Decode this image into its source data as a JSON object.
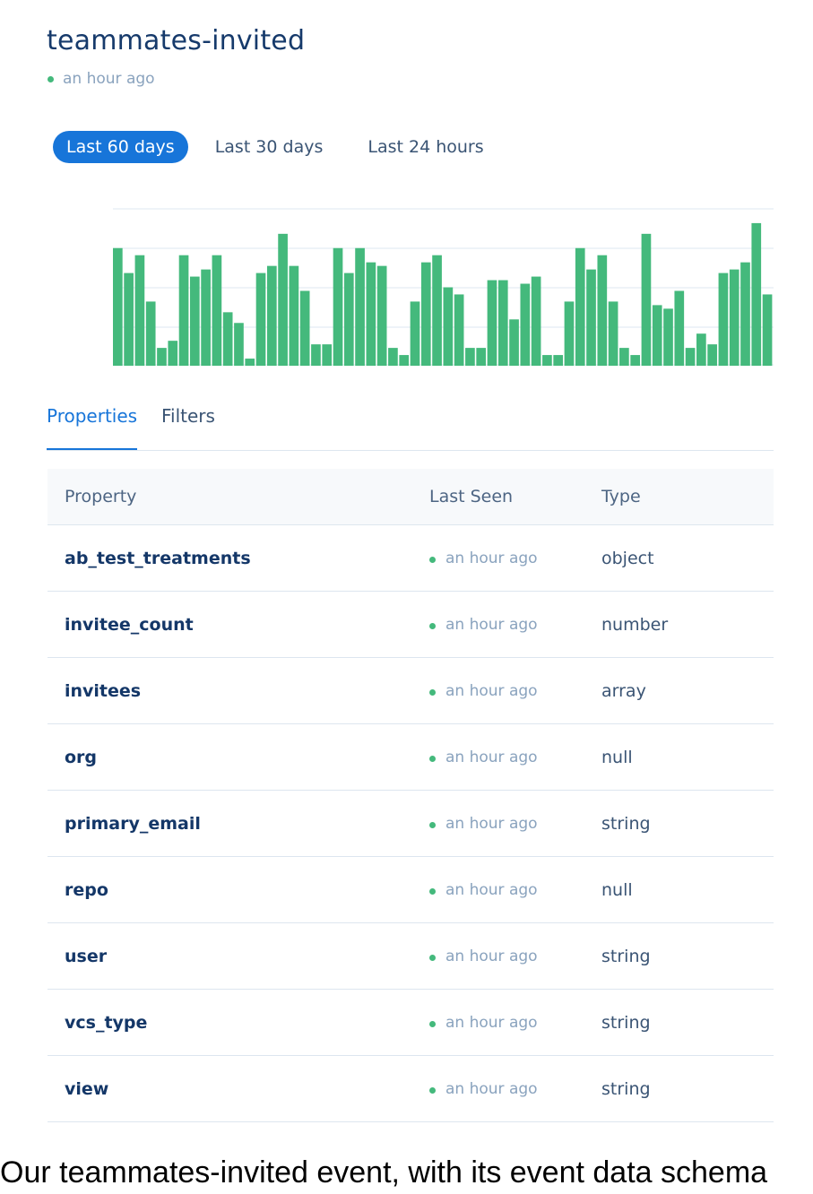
{
  "header": {
    "title": "teammates-invited",
    "last_seen": "an hour ago"
  },
  "ranges": [
    "Last 60 days",
    "Last 30 days",
    "Last 24 hours"
  ],
  "selected_range": "Last 60 days",
  "colors": {
    "accent": "#1775d9",
    "bar": "#44b97c",
    "status_dot": "#44b97c"
  },
  "chart_data": {
    "type": "bar",
    "grid": true,
    "ylim": [
      0,
      44
    ],
    "values": [
      33,
      26,
      31,
      18,
      5,
      7,
      31,
      25,
      27,
      31,
      15,
      12,
      2,
      26,
      28,
      37,
      28,
      21,
      6,
      6,
      33,
      26,
      33,
      29,
      28,
      5,
      3,
      18,
      29,
      31,
      22,
      20,
      5,
      5,
      24,
      24,
      13,
      23,
      25,
      3,
      3,
      18,
      33,
      27,
      31,
      18,
      5,
      3,
      37,
      17,
      16,
      21,
      5,
      9,
      6,
      26,
      27,
      29,
      40,
      20
    ]
  },
  "tabs": [
    "Properties",
    "Filters"
  ],
  "table": {
    "headers": [
      "Property",
      "Last Seen",
      "Type"
    ],
    "rows": [
      {
        "name": "ab_test_treatments",
        "last_seen": "an hour ago",
        "type": "object"
      },
      {
        "name": "invitee_count",
        "last_seen": "an hour ago",
        "type": "number"
      },
      {
        "name": "invitees",
        "last_seen": "an hour ago",
        "type": "array"
      },
      {
        "name": "org",
        "last_seen": "an hour ago",
        "type": "null"
      },
      {
        "name": "primary_email",
        "last_seen": "an hour ago",
        "type": "string"
      },
      {
        "name": "repo",
        "last_seen": "an hour ago",
        "type": "null"
      },
      {
        "name": "user",
        "last_seen": "an hour ago",
        "type": "string"
      },
      {
        "name": "vcs_type",
        "last_seen": "an hour ago",
        "type": "string"
      },
      {
        "name": "view",
        "last_seen": "an hour ago",
        "type": "string"
      }
    ]
  },
  "caption": "Our teammates-invited event, with its event data schema"
}
